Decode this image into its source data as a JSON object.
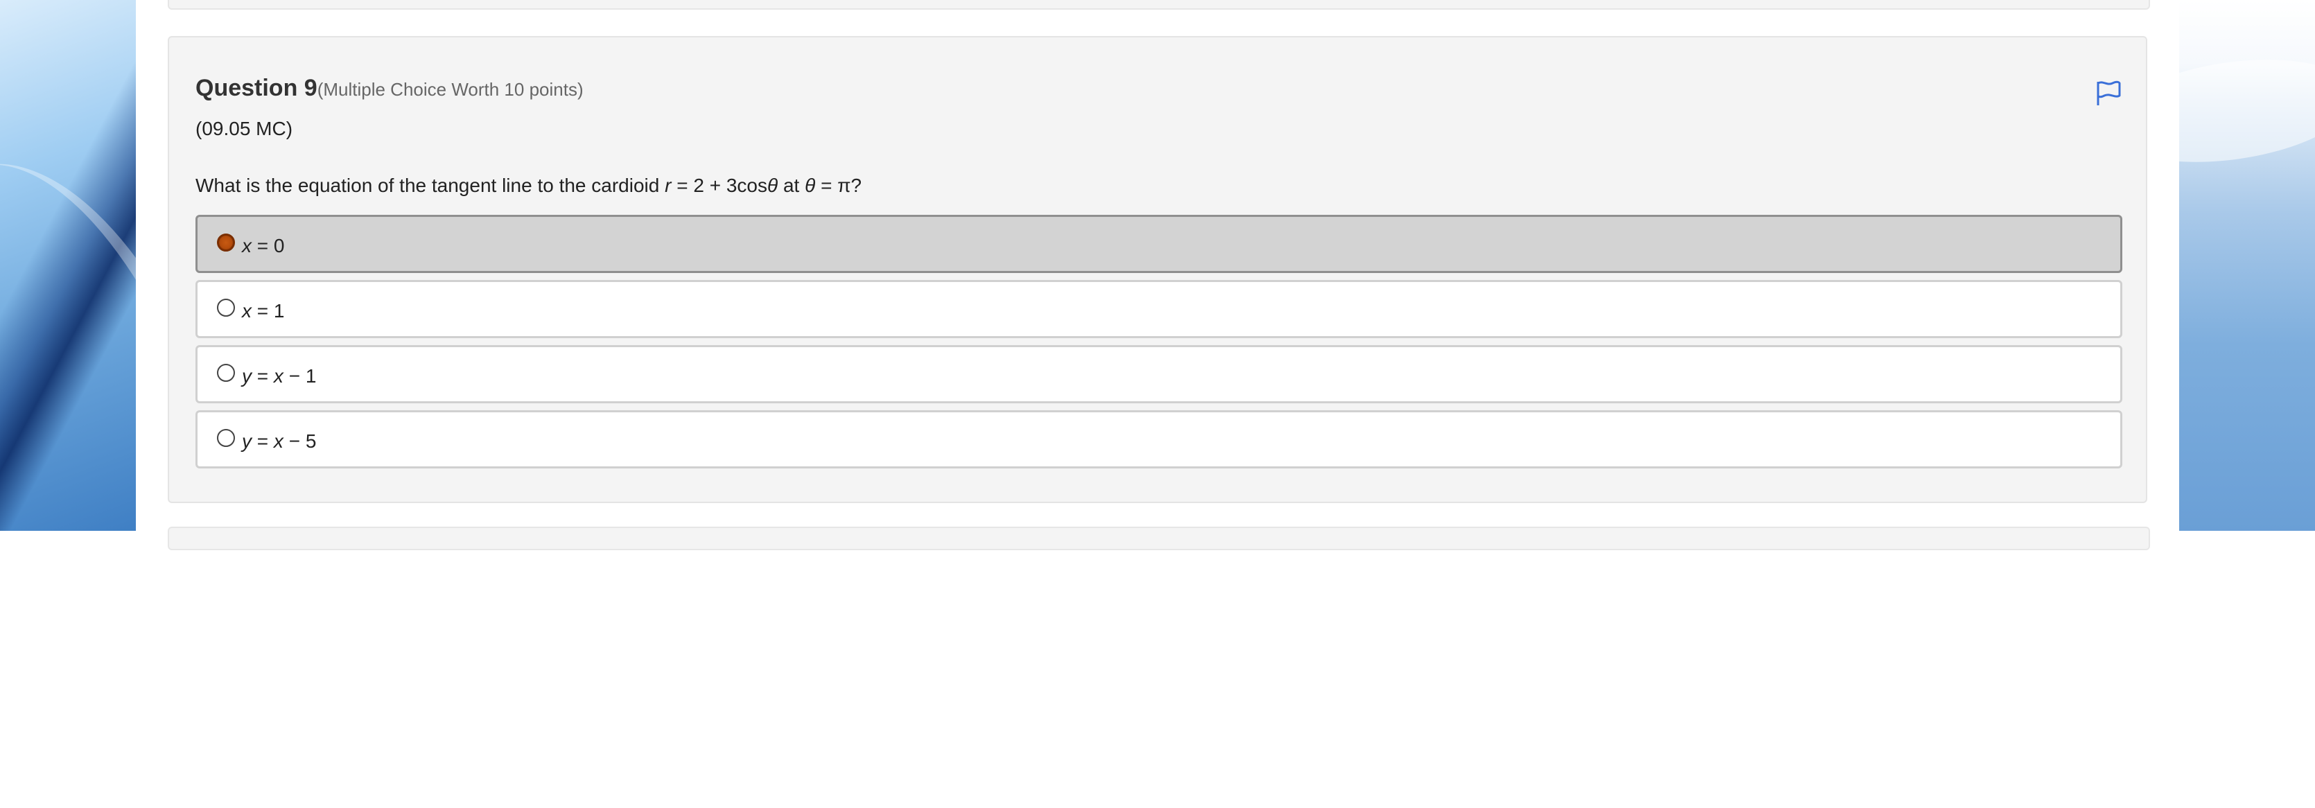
{
  "question": {
    "title": "Question 9",
    "type_worth": "(Multiple Choice Worth 10 points)",
    "code": "(09.05 MC)",
    "prompt_parts": {
      "before": "What is the equation of the tangent line to the cardioid ",
      "var_r": "r",
      "mid": " = 2 + 3cos",
      "var_theta1": "θ",
      "at": " at ",
      "var_theta2": "θ",
      "end": " = π?"
    },
    "flag_icon": "flag-icon"
  },
  "options": [
    {
      "var": "x",
      "rest": " = 0",
      "selected": true
    },
    {
      "var": "x",
      "rest": " = 1",
      "selected": false
    },
    {
      "var": "y",
      "rest": " = ",
      "var2": "x",
      "rest2": " − 1",
      "selected": false
    },
    {
      "var": "y",
      "rest": " = ",
      "var2": "x",
      "rest2": " − 5",
      "selected": false
    }
  ],
  "colors": {
    "flag": "#3a6fd8",
    "selected_radio": "#b64d0c",
    "card_bg": "#f4f4f4",
    "selected_option_bg": "#d3d3d3"
  }
}
